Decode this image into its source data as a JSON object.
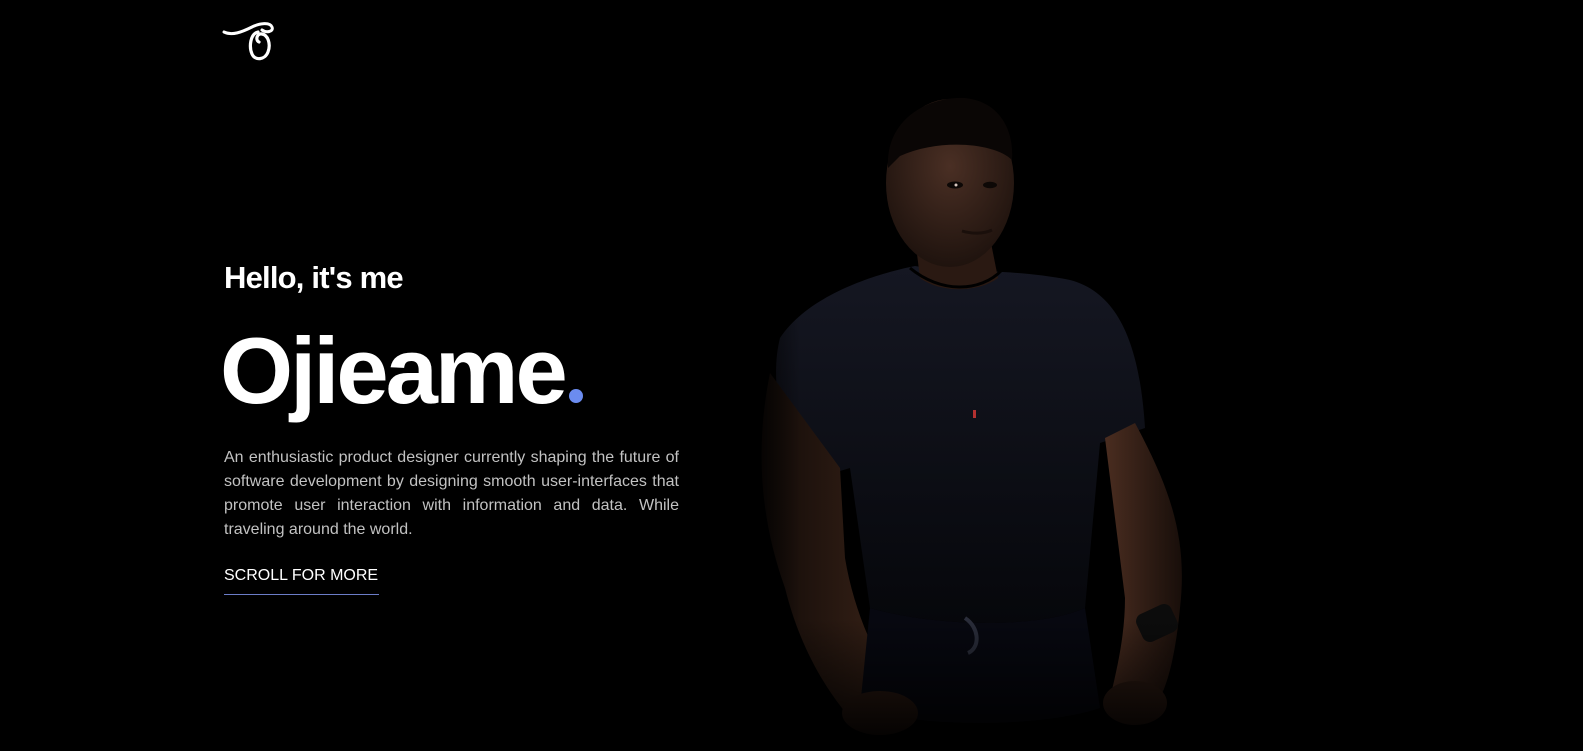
{
  "header": {
    "logo_icon": "script-o-logo-icon"
  },
  "hero": {
    "greeting": "Hello, it's me",
    "name": "Ojieame",
    "bio": "An enthusiastic product designer currently shaping the future of software development by designing smooth user-interfaces that promote user interaction with information and data. While traveling around the world.",
    "cta_label": "SCROLL FOR MORE",
    "portrait_icon": "person-portrait-image"
  },
  "colors": {
    "background": "#000000",
    "text": "#ffffff",
    "muted_text": "#c2c2c2",
    "accent": "#6b8cf0",
    "underline": "#6b7cc7"
  }
}
